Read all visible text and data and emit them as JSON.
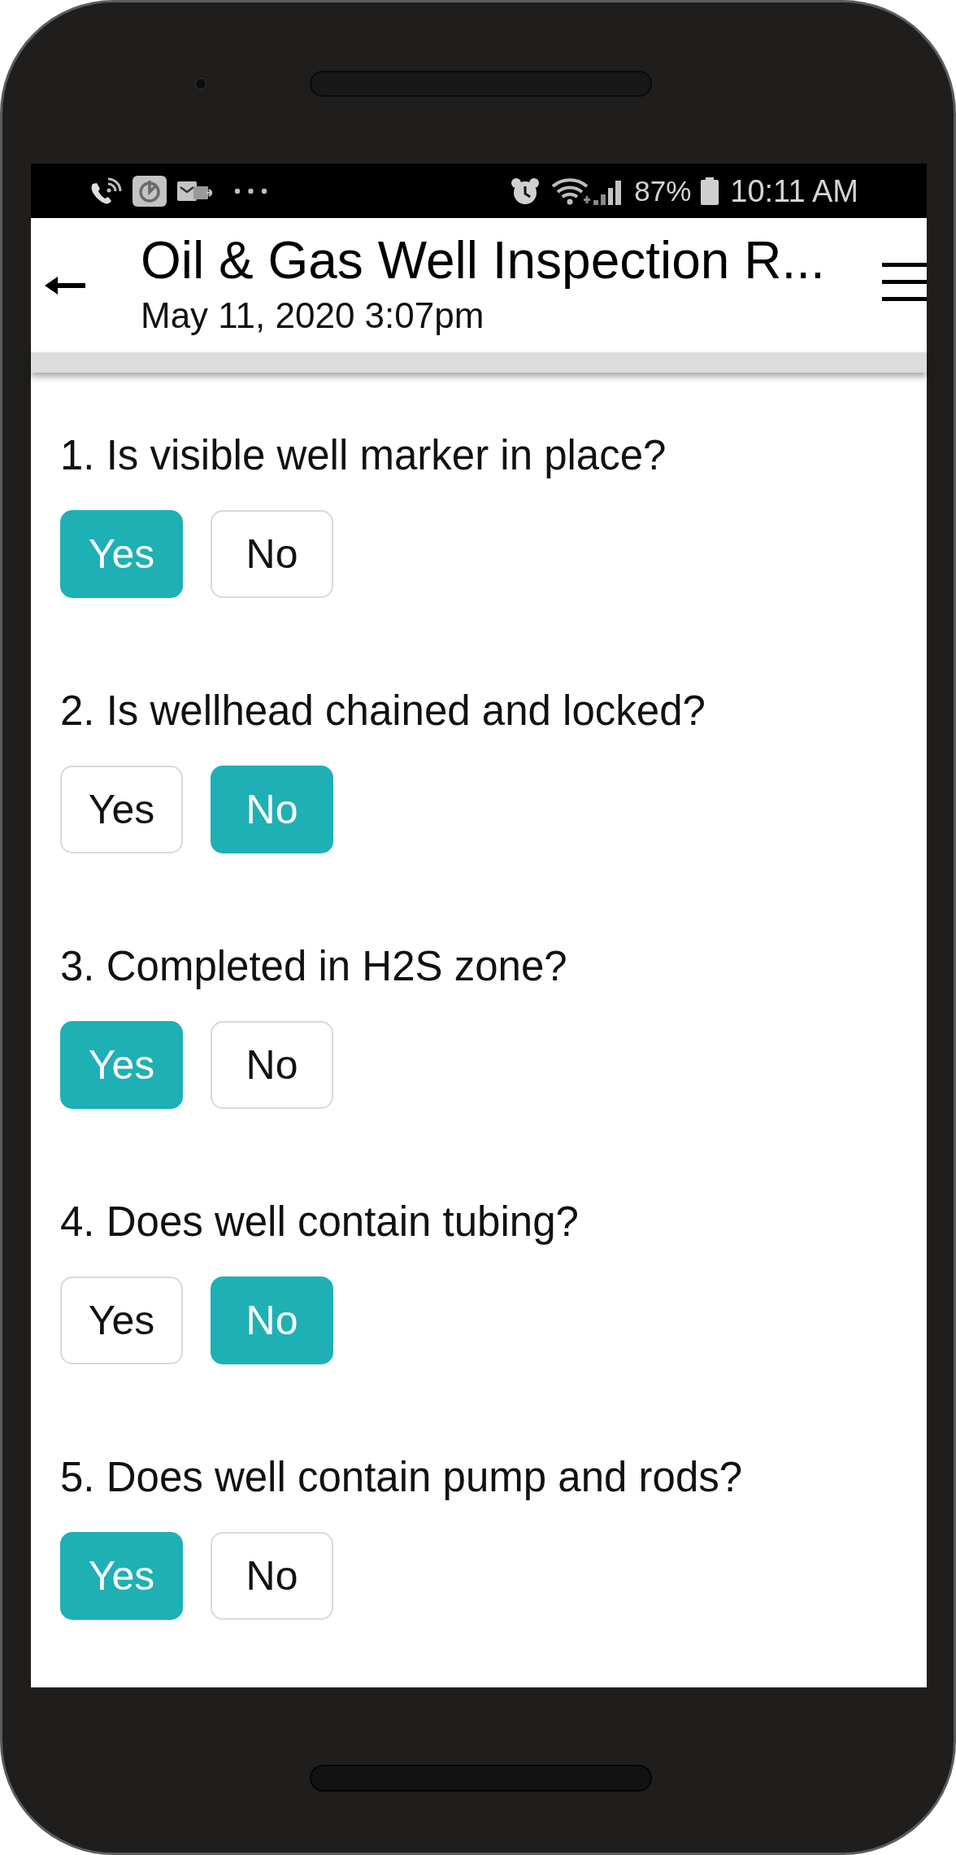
{
  "status_bar": {
    "battery": "87%",
    "time": "10:11 AM"
  },
  "header": {
    "title": "Oil & Gas Well Inspection R...",
    "subtitle": "May 11, 2020 3:07pm"
  },
  "questions": [
    {
      "text": "1. Is visible well marker in place?",
      "options": [
        {
          "label": "Yes",
          "selected": true
        },
        {
          "label": "No",
          "selected": false
        }
      ]
    },
    {
      "text": "2. Is wellhead chained and locked?",
      "options": [
        {
          "label": "Yes",
          "selected": false
        },
        {
          "label": "No",
          "selected": true
        }
      ]
    },
    {
      "text": "3. Completed in H2S zone?",
      "options": [
        {
          "label": "Yes",
          "selected": true
        },
        {
          "label": "No",
          "selected": false
        }
      ]
    },
    {
      "text": "4. Does well contain tubing?",
      "options": [
        {
          "label": "Yes",
          "selected": false
        },
        {
          "label": "No",
          "selected": true
        }
      ]
    },
    {
      "text": "5. Does well contain pump and rods?",
      "options": [
        {
          "label": "Yes",
          "selected": true
        },
        {
          "label": "No",
          "selected": false
        }
      ]
    }
  ]
}
